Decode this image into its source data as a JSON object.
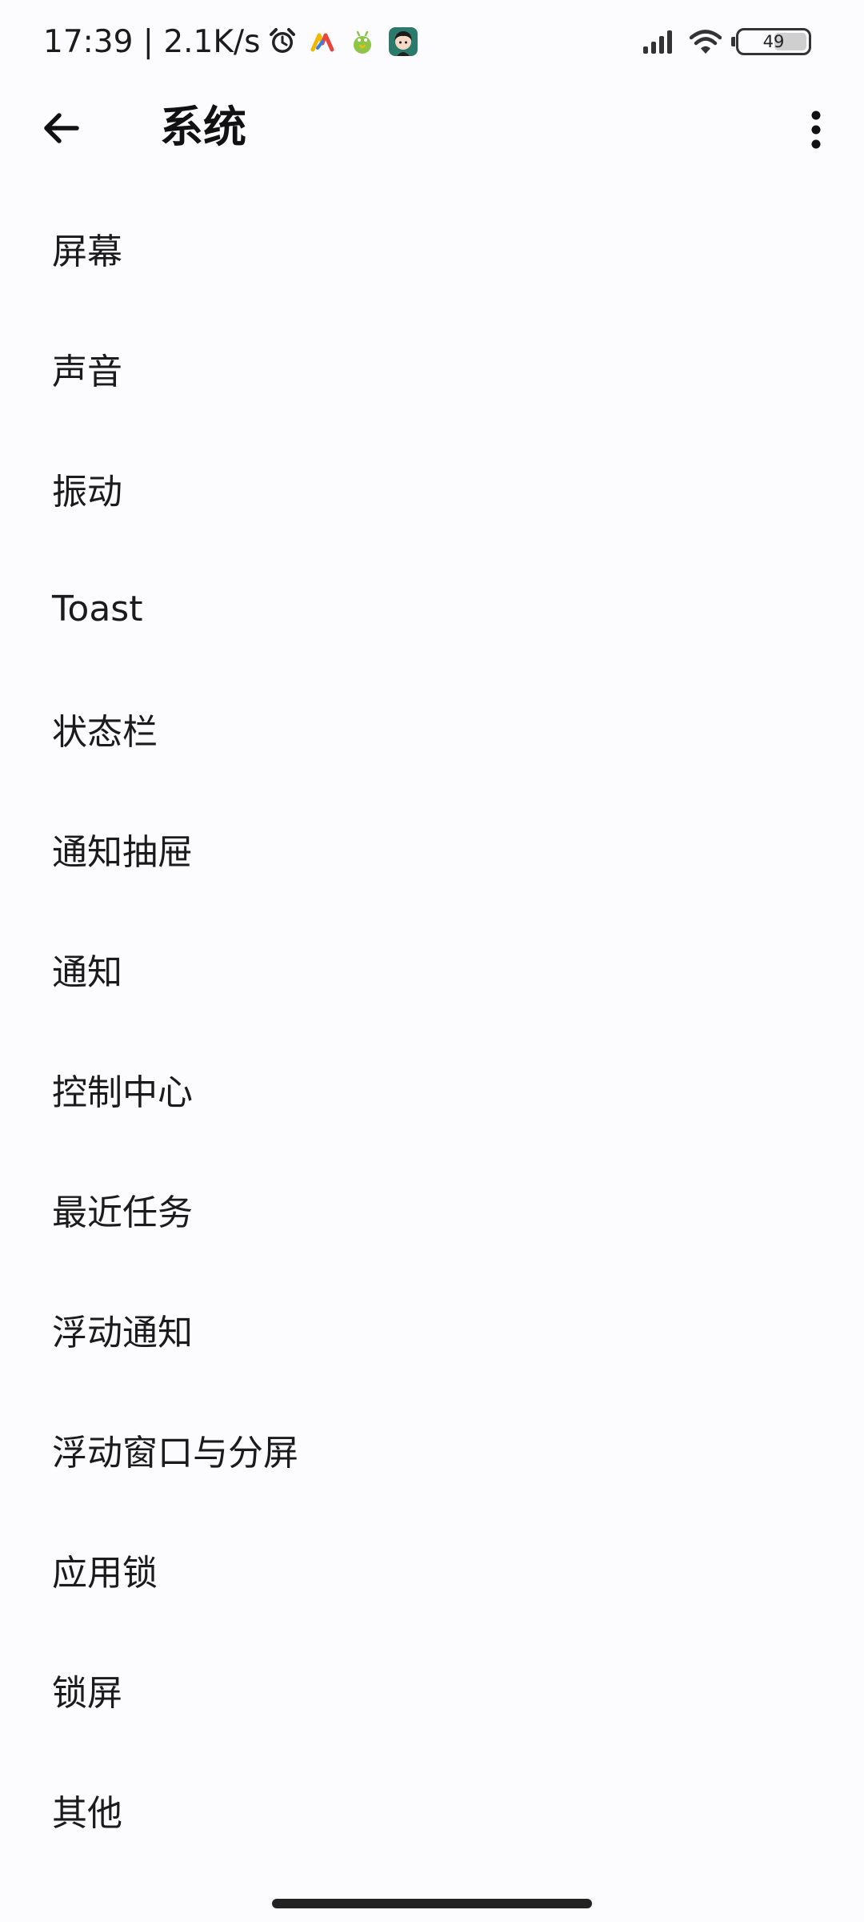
{
  "status_bar": {
    "time_speed": "17:39 | 2.1K/s",
    "battery_level": "49",
    "battery_percent": 49,
    "icons": [
      "alarm-icon",
      "app-notification-icon",
      "android-robot-icon",
      "avatar-app-icon",
      "signal-icon",
      "wifi-icon",
      "battery-icon"
    ]
  },
  "app_bar": {
    "title": "系统",
    "back_icon": "arrow-left-icon",
    "more_icon": "more-vertical-icon"
  },
  "settings": {
    "items": [
      {
        "label": "屏幕"
      },
      {
        "label": "声音"
      },
      {
        "label": "振动"
      },
      {
        "label": "Toast"
      },
      {
        "label": "状态栏"
      },
      {
        "label": "通知抽屉"
      },
      {
        "label": "通知"
      },
      {
        "label": "控制中心"
      },
      {
        "label": "最近任务"
      },
      {
        "label": "浮动通知"
      },
      {
        "label": "浮动窗口与分屏"
      },
      {
        "label": "应用锁"
      },
      {
        "label": "锁屏"
      },
      {
        "label": "其他"
      }
    ]
  },
  "colors": {
    "background": "#fcfbfe",
    "text": "#1b1b1b"
  }
}
